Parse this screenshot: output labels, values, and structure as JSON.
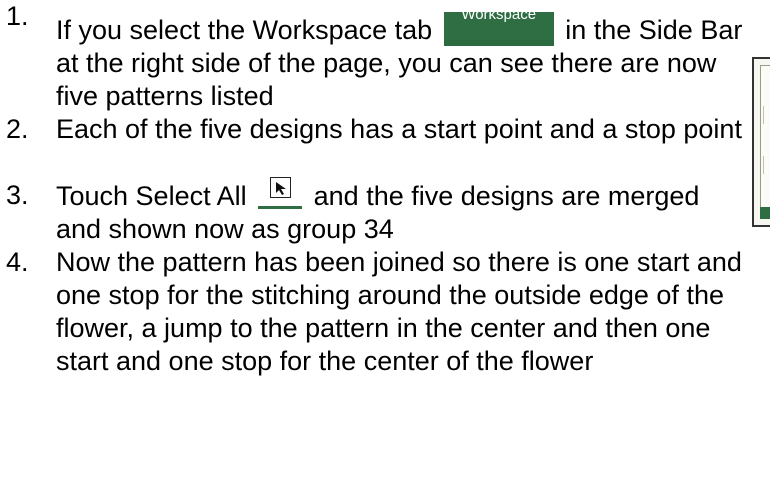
{
  "steps": [
    {
      "number": "1.",
      "text_before": "If you select the Workspace tab",
      "text_after": "in the Side Bar at the right side of the page, you can see there are now five patterns listed"
    },
    {
      "number": "2.",
      "text": "Each of the five designs has a start point and a stop point"
    },
    {
      "number": "3.",
      "text_before": "Touch Select All",
      "text_after": "and the five designs are merged and shown now as group 34"
    },
    {
      "number": "4.",
      "text": "Now the pattern has been joined so there is one start and one stop for the stitching around the outside edge of the flower, a jump to the pattern in the center and then one start and one stop for the center of the flower"
    }
  ],
  "workspace_tab_label": "Workspace",
  "icons": {
    "select_all": "select-all-icon",
    "workspace_tab": "workspace-tab-icon"
  },
  "colors": {
    "tab_green": "#2e6e42",
    "text": "#000000"
  }
}
